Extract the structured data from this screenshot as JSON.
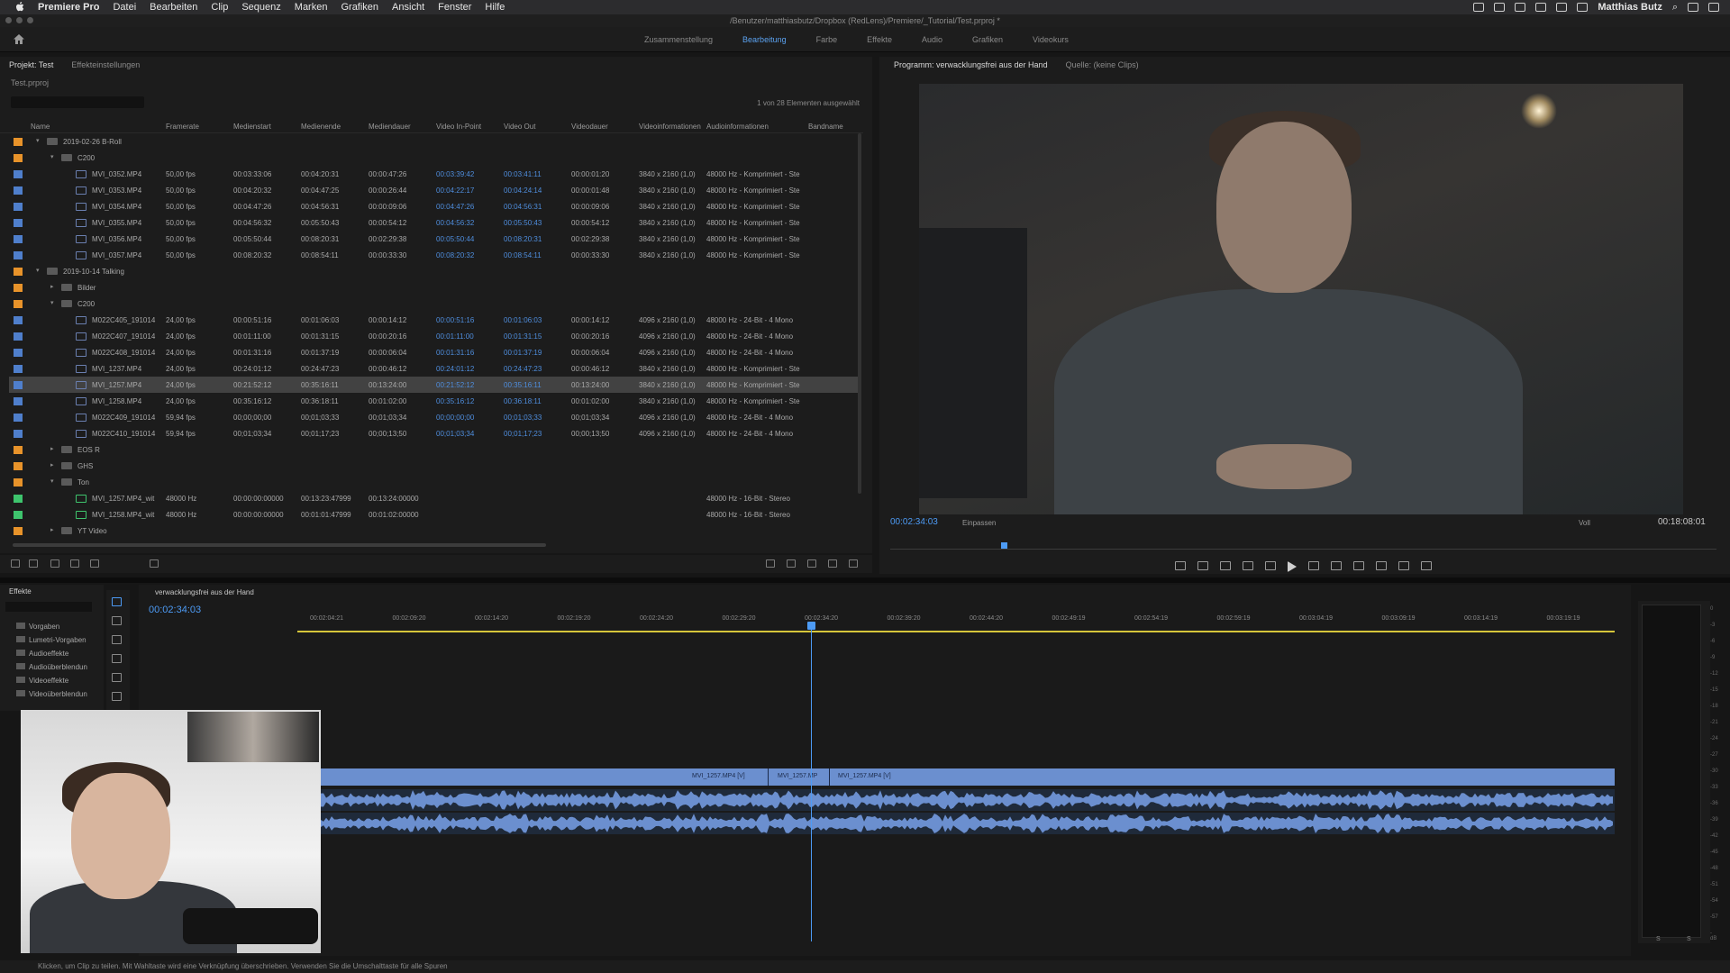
{
  "menubar": {
    "app": "Premiere Pro",
    "items": [
      "Datei",
      "Bearbeiten",
      "Clip",
      "Sequenz",
      "Marken",
      "Grafiken",
      "Ansicht",
      "Fenster",
      "Hilfe"
    ],
    "user": "Matthias Butz"
  },
  "titlebar": {
    "path": "/Benutzer/matthiasbutz/Dropbox (RedLens)/Premiere/_Tutorial/Test.prproj *"
  },
  "workspaces": {
    "items": [
      "Zusammenstellung",
      "Bearbeitung",
      "Farbe",
      "Effekte",
      "Audio",
      "Grafiken",
      "Videokurs"
    ],
    "active": "Bearbeitung"
  },
  "project": {
    "tabs": [
      "Projekt: Test",
      "Effekteinstellungen"
    ],
    "file": "Test.prproj",
    "selection_info": "1 von 28 Elementen ausgewählt",
    "columns": [
      "Name",
      "Framerate",
      "Medienstart",
      "Medienende",
      "Mediendauer",
      "Video In-Point",
      "Video Out",
      "Videodauer",
      "Videoinformationen",
      "Audioinformationen",
      "Bandname"
    ],
    "rows": [
      {
        "level": 0,
        "kind": "folder",
        "open": true,
        "color": "#e8932a",
        "name": "2019-02-26 B-Roll"
      },
      {
        "level": 1,
        "kind": "folder",
        "open": true,
        "color": "#e8932a",
        "name": "C200"
      },
      {
        "level": 2,
        "kind": "clip",
        "color": "#4f7fcc",
        "name": "MVI_0352.MP4",
        "fps": "50,00 fps",
        "start": "00:03:33:06",
        "end": "00:04:20:31",
        "dur": "00:00:47:26",
        "vin": "00:03:39:42",
        "vout": "00:03:41:11",
        "vdur": "00:00:01:20",
        "vinfo": "3840 x 2160 (1,0)",
        "ainfo": "48000 Hz - Komprimiert - Ste"
      },
      {
        "level": 2,
        "kind": "clip",
        "color": "#4f7fcc",
        "name": "MVI_0353.MP4",
        "fps": "50,00 fps",
        "start": "00:04:20:32",
        "end": "00:04:47:25",
        "dur": "00:00:26:44",
        "vin": "00:04:22:17",
        "vout": "00:04:24:14",
        "vdur": "00:00:01:48",
        "vinfo": "3840 x 2160 (1,0)",
        "ainfo": "48000 Hz - Komprimiert - Ste"
      },
      {
        "level": 2,
        "kind": "clip",
        "color": "#4f7fcc",
        "name": "MVI_0354.MP4",
        "fps": "50,00 fps",
        "start": "00:04:47:26",
        "end": "00:04:56:31",
        "dur": "00:00:09:06",
        "vin": "00:04:47:26",
        "vout": "00:04:56:31",
        "vdur": "00:00:09:06",
        "vinfo": "3840 x 2160 (1,0)",
        "ainfo": "48000 Hz - Komprimiert - Ste"
      },
      {
        "level": 2,
        "kind": "clip",
        "color": "#4f7fcc",
        "name": "MVI_0355.MP4",
        "fps": "50,00 fps",
        "start": "00:04:56:32",
        "end": "00:05:50:43",
        "dur": "00:00:54:12",
        "vin": "00:04:56:32",
        "vout": "00:05:50:43",
        "vdur": "00:00:54:12",
        "vinfo": "3840 x 2160 (1,0)",
        "ainfo": "48000 Hz - Komprimiert - Ste"
      },
      {
        "level": 2,
        "kind": "clip",
        "color": "#4f7fcc",
        "name": "MVI_0356.MP4",
        "fps": "50,00 fps",
        "start": "00:05:50:44",
        "end": "00:08:20:31",
        "dur": "00:02:29:38",
        "vin": "00:05:50:44",
        "vout": "00:08:20:31",
        "vdur": "00:02:29:38",
        "vinfo": "3840 x 2160 (1,0)",
        "ainfo": "48000 Hz - Komprimiert - Ste"
      },
      {
        "level": 2,
        "kind": "clip",
        "color": "#4f7fcc",
        "name": "MVI_0357.MP4",
        "fps": "50,00 fps",
        "start": "00:08:20:32",
        "end": "00:08:54:11",
        "dur": "00:00:33:30",
        "vin": "00:08:20:32",
        "vout": "00:08:54:11",
        "vdur": "00:00:33:30",
        "vinfo": "3840 x 2160 (1,0)",
        "ainfo": "48000 Hz - Komprimiert - Ste"
      },
      {
        "level": 0,
        "kind": "folder",
        "open": true,
        "color": "#e8932a",
        "name": "2019-10-14 Talking"
      },
      {
        "level": 1,
        "kind": "folder",
        "open": false,
        "color": "#e8932a",
        "name": "Bilder"
      },
      {
        "level": 1,
        "kind": "folder",
        "open": true,
        "color": "#e8932a",
        "name": "C200"
      },
      {
        "level": 2,
        "kind": "clip",
        "color": "#4f7fcc",
        "name": "M022C405_191014",
        "fps": "24,00 fps",
        "start": "00:00:51:16",
        "end": "00:01:06:03",
        "dur": "00:00:14:12",
        "vin": "00:00:51:16",
        "vout": "00:01:06:03",
        "vdur": "00:00:14:12",
        "vinfo": "4096 x 2160 (1,0)",
        "ainfo": "48000 Hz - 24-Bit - 4 Mono"
      },
      {
        "level": 2,
        "kind": "clip",
        "color": "#4f7fcc",
        "name": "M022C407_191014",
        "fps": "24,00 fps",
        "start": "00:01:11:00",
        "end": "00:01:31:15",
        "dur": "00:00:20:16",
        "vin": "00:01:11:00",
        "vout": "00:01:31:15",
        "vdur": "00:00:20:16",
        "vinfo": "4096 x 2160 (1,0)",
        "ainfo": "48000 Hz - 24-Bit - 4 Mono"
      },
      {
        "level": 2,
        "kind": "clip",
        "color": "#4f7fcc",
        "name": "M022C408_191014",
        "fps": "24,00 fps",
        "start": "00:01:31:16",
        "end": "00:01:37:19",
        "dur": "00:00:06:04",
        "vin": "00:01:31:16",
        "vout": "00:01:37:19",
        "vdur": "00:00:06:04",
        "vinfo": "4096 x 2160 (1,0)",
        "ainfo": "48000 Hz - 24-Bit - 4 Mono"
      },
      {
        "level": 2,
        "kind": "clip",
        "color": "#4f7fcc",
        "name": "MVI_1237.MP4",
        "fps": "24,00 fps",
        "start": "00:24:01:12",
        "end": "00:24:47:23",
        "dur": "00:00:46:12",
        "vin": "00:24:01:12",
        "vout": "00:24:47:23",
        "vdur": "00:00:46:12",
        "vinfo": "3840 x 2160 (1,0)",
        "ainfo": "48000 Hz - Komprimiert - Ste"
      },
      {
        "level": 2,
        "kind": "clip",
        "color": "#4f7fcc",
        "selected": true,
        "name": "MVI_1257.MP4",
        "fps": "24,00 fps",
        "start": "00:21:52:12",
        "end": "00:35:16:11",
        "dur": "00:13:24:00",
        "vin": "00:21:52:12",
        "vout": "00:35:16:11",
        "vdur": "00:13:24:00",
        "vinfo": "3840 x 2160 (1,0)",
        "ainfo": "48000 Hz - Komprimiert - Ste"
      },
      {
        "level": 2,
        "kind": "clip",
        "color": "#4f7fcc",
        "name": "MVI_1258.MP4",
        "fps": "24,00 fps",
        "start": "00:35:16:12",
        "end": "00:36:18:11",
        "dur": "00:01:02:00",
        "vin": "00:35:16:12",
        "vout": "00:36:18:11",
        "vdur": "00:01:02:00",
        "vinfo": "3840 x 2160 (1,0)",
        "ainfo": "48000 Hz - Komprimiert - Ste"
      },
      {
        "level": 2,
        "kind": "clip",
        "color": "#4f7fcc",
        "name": "M022C409_191014",
        "fps": "59,94 fps",
        "start": "00;00;00;00",
        "end": "00;01;03;33",
        "dur": "00;01;03;34",
        "vin": "00;00;00;00",
        "vout": "00;01;03;33",
        "vdur": "00;01;03;34",
        "vinfo": "4096 x 2160 (1,0)",
        "ainfo": "48000 Hz - 24-Bit - 4 Mono"
      },
      {
        "level": 2,
        "kind": "clip",
        "color": "#4f7fcc",
        "name": "M022C410_191014",
        "fps": "59,94 fps",
        "start": "00;01;03;34",
        "end": "00;01;17;23",
        "dur": "00;00;13;50",
        "vin": "00;01;03;34",
        "vout": "00;01;17;23",
        "vdur": "00;00;13;50",
        "vinfo": "4096 x 2160 (1,0)",
        "ainfo": "48000 Hz - 24-Bit - 4 Mono"
      },
      {
        "level": 1,
        "kind": "folder",
        "open": false,
        "color": "#e8932a",
        "name": "EOS R"
      },
      {
        "level": 1,
        "kind": "folder",
        "open": false,
        "color": "#e8932a",
        "name": "GHS"
      },
      {
        "level": 1,
        "kind": "folder",
        "open": true,
        "color": "#e8932a",
        "name": "Ton"
      },
      {
        "level": 2,
        "kind": "audio",
        "color": "#3ec46d",
        "name": "MVI_1257.MP4_wit",
        "fps": "48000  Hz",
        "start": "00:00:00:00000",
        "end": "00:13:23:47999",
        "dur": "00:13:24:00000",
        "vin": "",
        "vout": "",
        "vdur": "",
        "vinfo": "",
        "ainfo": "48000 Hz - 16-Bit - Stereo"
      },
      {
        "level": 2,
        "kind": "audio",
        "color": "#3ec46d",
        "name": "MVI_1258.MP4_wit",
        "fps": "48000  Hz",
        "start": "00:00:00:00000",
        "end": "00:01:01:47999",
        "dur": "00:01:02:00000",
        "vin": "",
        "vout": "",
        "vdur": "",
        "vinfo": "",
        "ainfo": "48000 Hz - 16-Bit - Stereo"
      },
      {
        "level": 1,
        "kind": "folder",
        "open": false,
        "color": "#e8932a",
        "name": "YT Video"
      }
    ]
  },
  "program": {
    "tabs": [
      "Programm: verwacklungsfrei aus der Hand",
      "Quelle: (keine Clips)"
    ],
    "timecode": "00:02:34:03",
    "fit": "Einpassen",
    "quality": "Voll",
    "duration": "00:18:08:01",
    "playhead_fraction": 0.134
  },
  "effects": {
    "title": "Effekte",
    "items": [
      "Vorgaben",
      "Lumetri-Vorgaben",
      "Audioeffekte",
      "Audioüberblendun",
      "Videoeffekte",
      "Videoüberblendun"
    ]
  },
  "timeline": {
    "sequence": "verwacklungsfrei aus der Hand",
    "timecode": "00:02:34:03",
    "ruler": [
      "00:02:04:21",
      "00:02:09:20",
      "00:02:14:20",
      "00:02:19:20",
      "00:02:24:20",
      "00:02:29:20",
      "00:02:34:20",
      "00:02:39:20",
      "00:02:44:20",
      "00:02:49:19",
      "00:02:54:19",
      "00:02:59:19",
      "00:03:04:19",
      "00:03:09:19",
      "00:03:14:19",
      "00:03:19:19"
    ],
    "clip_labels": [
      "MVI_1257.MP4 [V]",
      "MVI_1257.MP",
      "MVI_1257.MP4 [V]"
    ]
  },
  "meters": {
    "labels": [
      "0",
      "-3",
      "-6",
      "-9",
      "-12",
      "-15",
      "-18",
      "-21",
      "-24",
      "-27",
      "-30",
      "-33",
      "-36",
      "-39",
      "-42",
      "-45",
      "-48",
      "-51",
      "-54",
      "-57",
      "-dB"
    ],
    "solo": [
      "S",
      "S"
    ]
  },
  "status": {
    "hint": "Klicken, um Clip zu teilen. Mit Wahltaste wird eine Verknüpfung überschrieben. Verwenden Sie die Umschalttaste für alle Spuren"
  }
}
